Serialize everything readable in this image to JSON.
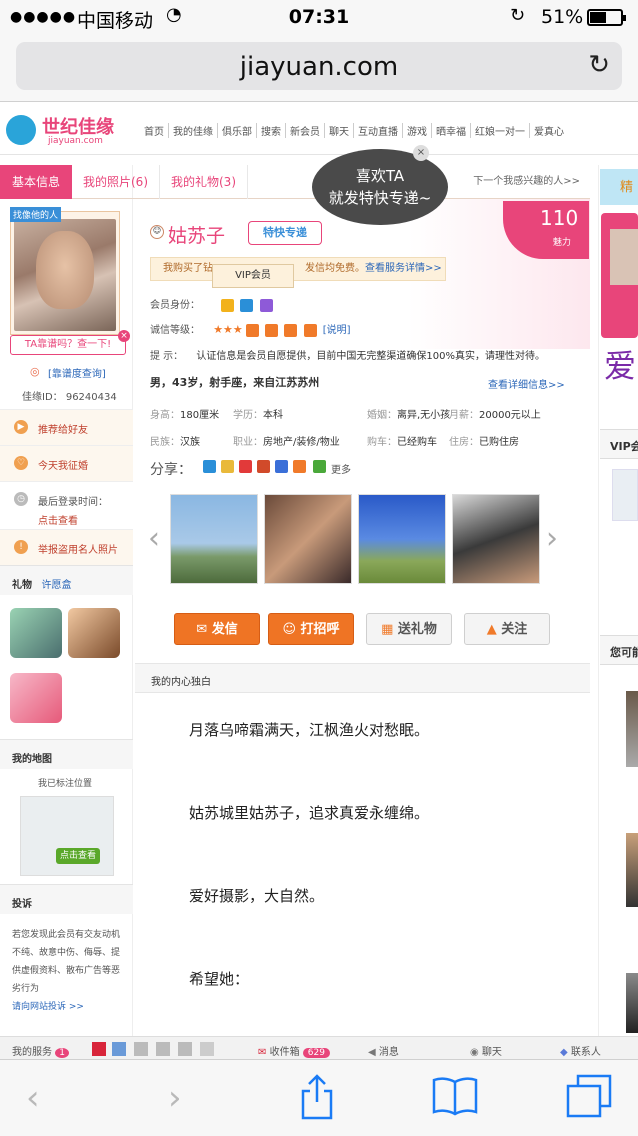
{
  "status_bar": {
    "signal": "●●●●●",
    "carrier": "中国移动",
    "time": "07:31",
    "battery": "51%"
  },
  "browser": {
    "url": "jiayuan.com"
  },
  "logo": {
    "cn": "世纪佳缘",
    "en": "jiayuan.com"
  },
  "nav": [
    "首页",
    "我的佳缘",
    "俱乐部",
    "搜索",
    "新会员",
    "聊天",
    "互动直播",
    "游戏",
    "晒幸福",
    "红娘一对一",
    "爱真心"
  ],
  "tabs": {
    "basic": "基本信息",
    "photos": "我的照片(6)",
    "gifts": "我的礼物(3)",
    "next": "下一个我感兴趣的人>>"
  },
  "left": {
    "avatar_tag": "找像他的人",
    "pupu": "TA靠谱吗？查一下!",
    "chaxun": "[靠谱度查询]",
    "jyid": "佳缘ID：  96240434",
    "menu": [
      "推荐给好友",
      "今天我征婚",
      "最后登录时间：",
      "点击查看",
      "举报盗用名人照片"
    ],
    "gifts_header": "礼物",
    "wishbox": "许愿盒",
    "map_header": "我的地图",
    "map_marked": "我已标注位置",
    "map_btn": "点击查看",
    "report_header": "投诉",
    "report_text": "若您发现此会员有交友动机不纯、故意中伤、侮辱、提供虚假资料、散布广告等恶劣行为",
    "report_link": "请向网站投诉 >>"
  },
  "profile": {
    "score": "110",
    "meili": "魅力",
    "nickname": "姑苏子",
    "tkzd": "特快专递",
    "bubble_line1": "喜欢TA",
    "bubble_line2": "就发特快专递~",
    "svc_prefix": "我购买了钻",
    "svc_mid": "发信均免费。",
    "svc_link": "查看服务详情>>",
    "vip_tip": "VIP会员",
    "member_label": "会员身份：",
    "credit_label": "诚信等级：",
    "credit_stars": "★★★",
    "credit_link": "[说明]",
    "tip_label": "提      示：",
    "tip_text": "认证信息是会员自愿提供，目前中国无完整渠道确保100%真实，请理性对待。",
    "summary_prefix": "男，",
    "summary_age": "43",
    "summary_rest": "岁，射手座，来自江苏苏州",
    "details_link": "查看详细信息>>",
    "details": [
      {
        "k": "身高：",
        "v": "180厘米"
      },
      {
        "k": "学历：",
        "v": "本科"
      },
      {
        "k": "婚姻：",
        "v": "离异,无小孩"
      },
      {
        "k": "月薪：",
        "v": "20000元以上"
      },
      {
        "k": "民族：",
        "v": "汉族"
      },
      {
        "k": "职业：",
        "v": "房地产/装修/物业"
      },
      {
        "k": "购车：",
        "v": "已经购车"
      },
      {
        "k": "住房：",
        "v": "已购住房"
      }
    ],
    "share_label": "分享：",
    "share_more": "更多"
  },
  "actions": {
    "write": "发信",
    "greet": "打招呼",
    "gift": "送礼物",
    "follow": "关注"
  },
  "monologue": {
    "header": "我的内心独白",
    "lines": [
      "月落乌啼霜满天，江枫渔火对愁眠。",
      "姑苏城里姑苏子，追求真爱永缠绵。",
      "爱好摄影，大自然。",
      "希望她："
    ]
  },
  "right": {
    "vip": "VIP会",
    "maybe": "您可能",
    "jing": "精"
  },
  "bottombar": {
    "my_service": "我的服务",
    "my_service_count": "1",
    "inbox": "收件箱",
    "inbox_count": "629",
    "message": "消息",
    "chat": "聊天",
    "contacts": "联系人"
  },
  "toolbar": {
    "back": "‹",
    "forward": "›"
  }
}
